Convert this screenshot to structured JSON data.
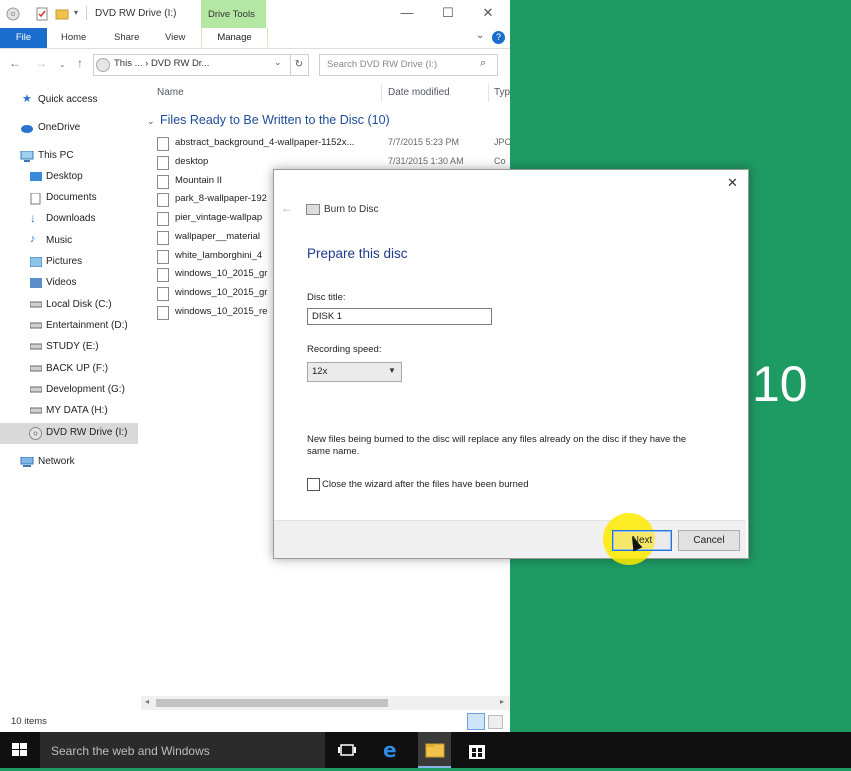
{
  "explorer": {
    "title": "DVD RW Drive (I:)",
    "drive_tools_label": "Drive Tools",
    "ribbon_tabs": [
      "File",
      "Home",
      "Share",
      "View",
      "Manage"
    ],
    "address": {
      "text": "This ... › DVD RW Dr..."
    },
    "search_placeholder": "Search DVD RW Drive (I:)",
    "nav_items": [
      {
        "label": "Quick access",
        "icon": "star-icon"
      },
      {
        "label": "OneDrive",
        "icon": "cloud-icon"
      },
      {
        "label": "This PC",
        "icon": "computer-icon"
      },
      {
        "label": "Desktop",
        "icon": "desktop-folder-icon"
      },
      {
        "label": "Documents",
        "icon": "documents-icon"
      },
      {
        "label": "Downloads",
        "icon": "download-icon"
      },
      {
        "label": "Music",
        "icon": "music-icon"
      },
      {
        "label": "Pictures",
        "icon": "pictures-icon"
      },
      {
        "label": "Videos",
        "icon": "videos-icon"
      },
      {
        "label": "Local Disk (C:)",
        "icon": "drive-icon"
      },
      {
        "label": "Entertainment (D:)",
        "icon": "drive-icon"
      },
      {
        "label": "STUDY (E:)",
        "icon": "drive-icon"
      },
      {
        "label": "BACK UP (F:)",
        "icon": "drive-icon"
      },
      {
        "label": "Development (G:)",
        "icon": "drive-icon"
      },
      {
        "label": "MY DATA (H:)",
        "icon": "drive-icon"
      },
      {
        "label": "DVD RW Drive (I:)",
        "icon": "dvd-drive-icon"
      },
      {
        "label": "Network",
        "icon": "network-icon"
      }
    ],
    "columns": {
      "name": "Name",
      "date_modified": "Date modified",
      "type": "Typ"
    },
    "group_header": "Files Ready to Be Written to the Disc (10)",
    "files": [
      {
        "name": "abstract_background_4-wallpaper-1152x...",
        "date": "7/7/2015 5:23 PM",
        "type": "JPC"
      },
      {
        "name": "desktop",
        "date": "7/31/2015 1:30 AM",
        "type": "Co"
      },
      {
        "name": "Mountain II",
        "date": "",
        "type": ""
      },
      {
        "name": "park_8-wallpaper-192",
        "date": "",
        "type": ""
      },
      {
        "name": "pier_vintage-wallpap",
        "date": "",
        "type": ""
      },
      {
        "name": "wallpaper__material",
        "date": "",
        "type": ""
      },
      {
        "name": "white_lamborghini_4",
        "date": "",
        "type": ""
      },
      {
        "name": "windows_10_2015_gr",
        "date": "",
        "type": ""
      },
      {
        "name": "windows_10_2015_gr",
        "date": "",
        "type": ""
      },
      {
        "name": "windows_10_2015_re",
        "date": "",
        "type": ""
      }
    ],
    "status": "10 items"
  },
  "dialog": {
    "title": "Burn to Disc",
    "heading": "Prepare this disc",
    "disc_title_label": "Disc title:",
    "disc_title_value": "DISK 1",
    "speed_label": "Recording speed:",
    "speed_value": "12x",
    "warning": "New files being burned to the disc will replace any files already on the disc if they have the same name.",
    "close_wizard_label": "Close the wizard after the files have been burned",
    "next_label": "Next",
    "cancel_label": "Cancel"
  },
  "desktop": {
    "text": "10"
  },
  "taskbar": {
    "search_text": "Search the web and Windows"
  },
  "colors": {
    "accent": "#1a6dcc",
    "desktop": "#1e9a63",
    "drive_tools": "#b5e7a4"
  }
}
